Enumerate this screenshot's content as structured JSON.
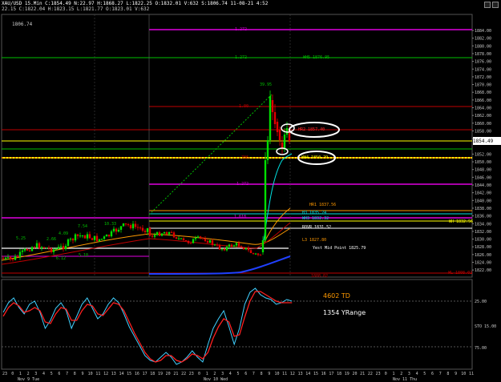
{
  "header": {
    "line1": "XAU/USD 15.Min  C:1854.49  N:22.97  H:1868.27  L:1822.25  O:1832.01  V:632  S:1806.74  11-08-21  4:52",
    "line2": "22.15  C:1822.04  H:1823.15  L:1821.77  O:1823.01  V:632",
    "price_tag": "1806.74"
  },
  "price_axis": [
    "1884.00",
    "1882.00",
    "1880.00",
    "1878.00",
    "1876.00",
    "1874.00",
    "1872.00",
    "1870.00",
    "1868.00",
    "1866.00",
    "1864.00",
    "1862.00",
    "1860.00",
    "1858.00",
    "1856.00",
    "1854.49",
    "1852.00",
    "1850.00",
    "1848.00",
    "1846.00",
    "1844.00",
    "1842.00",
    "1840.00",
    "1838.00",
    "1836.00",
    "1834.00",
    "1832.00",
    "1830.00",
    "1828.00",
    "1826.00",
    "1824.00",
    "1822.00"
  ],
  "level_labels": {
    "fib_top": "1.272",
    "fib_upper": "1.272",
    "wh5": "WH5 1876.95",
    "w_hi": "39.95",
    "fib_1": "1.00",
    "hr2": "HR2 1857.40",
    "last": "1854.49",
    "fib_mid": ".786",
    "wh4": "WH4 1850.29",
    "fib_1272": "1.272",
    "hr1": "HR1 1837.56",
    "h3": "H3 1835.24",
    "fib_lo": "1.618",
    "wh3": "WH3 1832.32",
    "wh_right": "WH 1832.56",
    "rovr": "ROVR 1831.52",
    "l3": "L3 1827.80",
    "yest_mid": "Yest Mid Point 1825.79",
    "wl": "WL 1808.02",
    "pivot_bottom": "1808.02",
    "lbl_525": "5.25",
    "lbl_266": "2.66",
    "lbl_409": "4.09",
    "lbl_754": "7.54",
    "lbl_1033": "10.33",
    "lbl_612": "6.12",
    "lbl_510": "5.10"
  },
  "indicator": {
    "td_text": "4602 TD",
    "yrange_text": "1354 YRange",
    "axis": [
      "25.00",
      "STO 15.00",
      "75.00"
    ]
  },
  "time_axis": {
    "ticks": [
      "23",
      "0",
      "1",
      "2",
      "3",
      "4",
      "5",
      "6",
      "7",
      "8",
      "9",
      "10",
      "11",
      "12",
      "13",
      "14",
      "15",
      "16",
      "17",
      "18",
      "19",
      "20",
      "21",
      "22",
      "23",
      "0",
      "1",
      "2",
      "3",
      "4",
      "5",
      "6",
      "7",
      "8",
      "9",
      "10",
      "11",
      "12",
      "13",
      "14",
      "15",
      "16",
      "17",
      "18",
      "19",
      "20",
      "21",
      "22",
      "23",
      "0",
      "1",
      "2",
      "3",
      "4",
      "5",
      "6",
      "7",
      "8",
      "9",
      "10",
      "11"
    ],
    "day_labels": [
      "Nov 9 Tue",
      "Nov 10 Wed",
      "Nov 11 Thu"
    ]
  },
  "colors": {
    "green_line": "#00c000",
    "magenta_line": "#e000e0",
    "yellow_line": "#ffff00",
    "cyan_line": "#00e0e0",
    "red_line": "#c00000",
    "stoch_fast": "#40d0ff",
    "stoch_slow": "#ff2020",
    "orange": "#ff9900"
  }
}
